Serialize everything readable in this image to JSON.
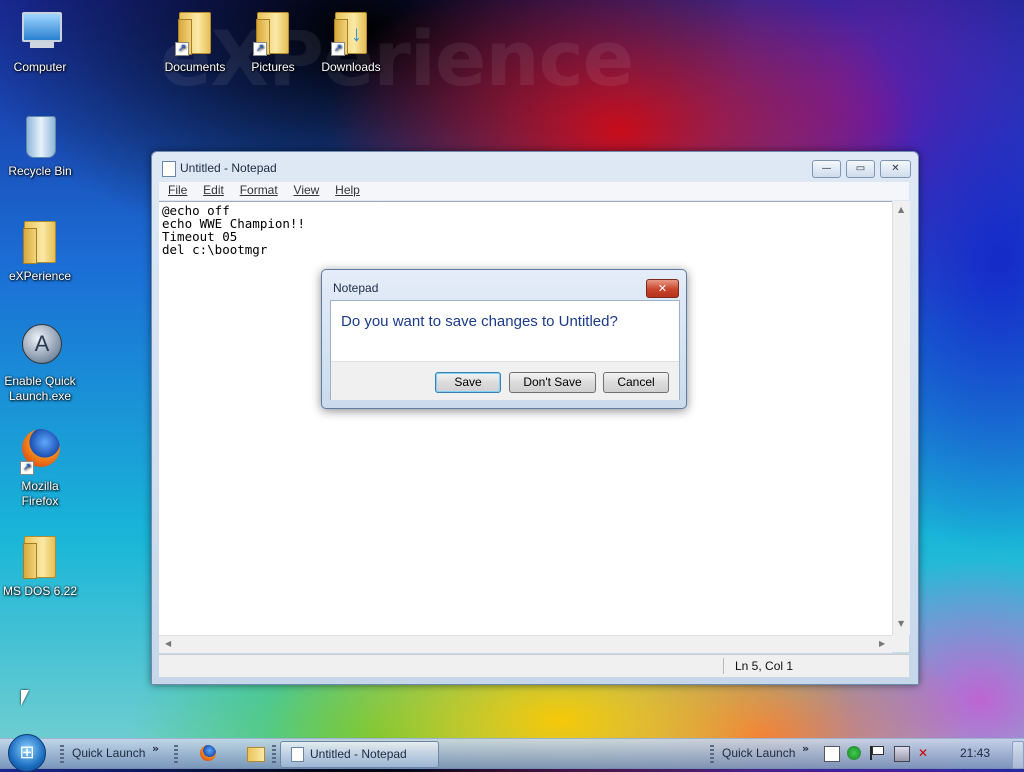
{
  "desktop": {
    "icons": [
      {
        "label": "Computer",
        "icon": "computer-icon"
      },
      {
        "label": "Documents",
        "icon": "folder-icon"
      },
      {
        "label": "Pictures",
        "icon": "folder-icon"
      },
      {
        "label": "Downloads",
        "icon": "folder-download-icon"
      },
      {
        "label": "Recycle Bin",
        "icon": "recycle-bin-icon"
      },
      {
        "label": "eXPerience",
        "icon": "folder-icon"
      },
      {
        "label": "Enable Quick\nLaunch.exe",
        "line1": "Enable Quick",
        "line2": "Launch.exe",
        "icon": "app-icon"
      },
      {
        "label": "Mozilla\nFirefox",
        "line1": "Mozilla",
        "line2": "Firefox",
        "icon": "firefox-icon"
      },
      {
        "label": "MS DOS 6.22",
        "icon": "folder-icon"
      }
    ],
    "watermark": "eXPerience"
  },
  "notepad": {
    "title": "Untitled - Notepad",
    "menu": [
      "File",
      "Edit",
      "Format",
      "View",
      "Help"
    ],
    "content": "@echo off\necho WWE Champion!!\nTimeout 05\ndel c:\\bootmgr",
    "status": "Ln 5, Col 1",
    "caption_buttons": {
      "minimize": "—",
      "restore": "▭",
      "close": "✕"
    }
  },
  "dialog": {
    "title": "Notepad",
    "message": "Do you want to save changes to Untitled?",
    "buttons": {
      "save": "Save",
      "dont_save": "Don't Save",
      "cancel": "Cancel"
    },
    "close_glyph": "✕"
  },
  "taskbar": {
    "quick_launch_left": "Quick Launch",
    "task": "Untitled - Notepad",
    "quick_launch_right": "Quick Launch",
    "clock": "21:43",
    "chevron": "»"
  },
  "colors": {
    "dialog_text": "#1a3a8a",
    "close_red": "#c9442b"
  }
}
